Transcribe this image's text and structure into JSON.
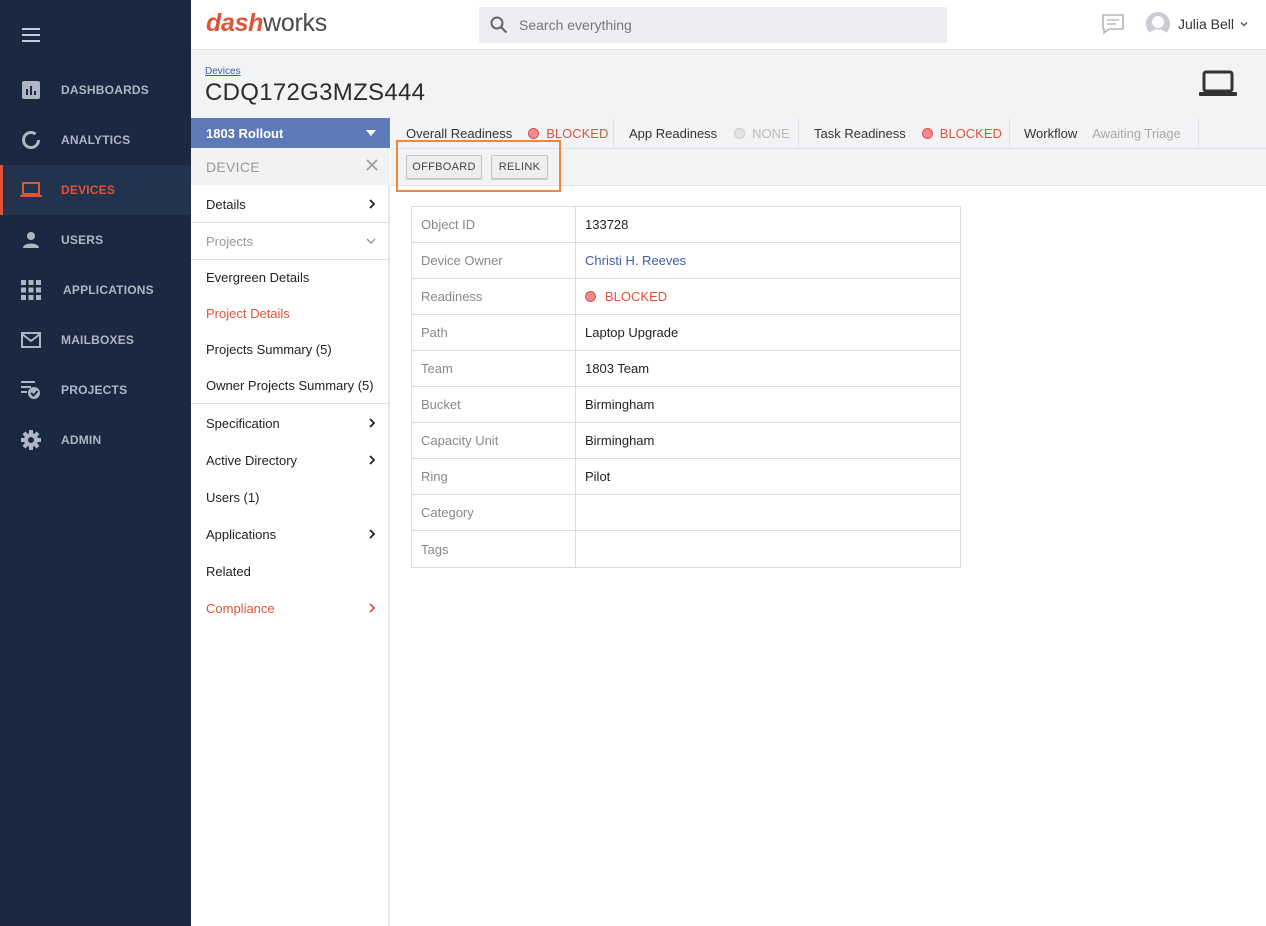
{
  "nav": {
    "items": [
      {
        "label": "DASHBOARDS",
        "icon": "bar-chart-icon"
      },
      {
        "label": "ANALYTICS",
        "icon": "donut-chart-icon"
      },
      {
        "label": "DEVICES",
        "icon": "laptop-icon",
        "active": true
      },
      {
        "label": "USERS",
        "icon": "user-icon"
      },
      {
        "label": "APPLICATIONS",
        "icon": "grid-icon"
      },
      {
        "label": "MAILBOXES",
        "icon": "envelope-icon"
      },
      {
        "label": "PROJECTS",
        "icon": "project-check-icon"
      },
      {
        "label": "ADMIN",
        "icon": "gear-icon"
      }
    ]
  },
  "topbar": {
    "logo_part1": "dash",
    "logo_part2": "works",
    "search_placeholder": "Search everything",
    "user_name": "Julia Bell"
  },
  "header": {
    "breadcrumb": "Devices",
    "title": "CDQ172G3MZS444"
  },
  "side": {
    "project": "1803 Rollout",
    "section": "DEVICE",
    "items": {
      "details": "Details",
      "projects": "Projects",
      "evergreen": "Evergreen Details",
      "project_details": "Project Details",
      "projects_summary": "Projects Summary (5)",
      "owner_projects_summary": "Owner Projects Summary (5)",
      "specification": "Specification",
      "active_directory": "Active Directory",
      "users": "Users (1)",
      "applications": "Applications",
      "related": "Related",
      "compliance": "Compliance"
    }
  },
  "readiness": {
    "overall_label": "Overall Readiness",
    "overall_value": "BLOCKED",
    "app_label": "App Readiness",
    "app_value": "NONE",
    "task_label": "Task Readiness",
    "task_value": "BLOCKED",
    "workflow_label": "Workflow",
    "workflow_value": "Awaiting Triage"
  },
  "actions": {
    "offboard": "OFFBOARD",
    "relink": "RELINK"
  },
  "details": [
    {
      "key": "Object ID",
      "value": "133728"
    },
    {
      "key": "Device Owner",
      "value": "Christi H. Reeves"
    },
    {
      "key": "Readiness",
      "value": "BLOCKED"
    },
    {
      "key": "Path",
      "value": "Laptop Upgrade"
    },
    {
      "key": "Team",
      "value": "1803 Team"
    },
    {
      "key": "Bucket",
      "value": "Birmingham"
    },
    {
      "key": "Capacity Unit",
      "value": "Birmingham"
    },
    {
      "key": "Ring",
      "value": "Pilot"
    },
    {
      "key": "Category",
      "value": ""
    },
    {
      "key": "Tags",
      "value": ""
    }
  ],
  "colors": {
    "nav_bg": "#1a2841",
    "accent": "#e0533b",
    "link": "#3c5ea8",
    "project_bar": "#5b7ab7",
    "highlight": "#f0883a"
  }
}
